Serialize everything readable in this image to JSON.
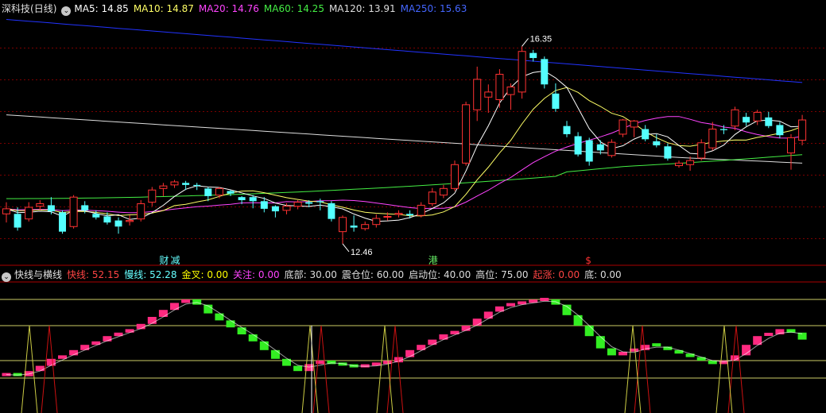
{
  "main_legend": {
    "stock": "深科技",
    "period": "(日线)",
    "items": [
      {
        "label": "MA5:",
        "value": "14.85",
        "color": "#ffffff"
      },
      {
        "label": "MA10:",
        "value": "14.87",
        "color": "#ffff66"
      },
      {
        "label": "MA20:",
        "value": "14.76",
        "color": "#ff44ff"
      },
      {
        "label": "MA60:",
        "value": "14.25",
        "color": "#44ee44"
      },
      {
        "label": "MA120:",
        "value": "13.91",
        "color": "#dddddd"
      },
      {
        "label": "MA250:",
        "value": "15.63",
        "color": "#4466ff"
      }
    ]
  },
  "sub_legend": {
    "name": "快线与横线",
    "items": [
      {
        "label": "快线:",
        "value": "52.15",
        "color": "#ff4444"
      },
      {
        "label": "慢线:",
        "value": "52.28",
        "color": "#66ffff"
      },
      {
        "label": "金叉:",
        "value": "0.00",
        "color": "#ffff00"
      },
      {
        "label": "关注:",
        "value": "0.00",
        "color": "#ff44ff"
      },
      {
        "label": "底部:",
        "value": "30.00",
        "color": "#dddddd"
      },
      {
        "label": "震仓位:",
        "value": "60.00",
        "color": "#dddddd"
      },
      {
        "label": "启动位:",
        "value": "40.00",
        "color": "#dddddd"
      },
      {
        "label": "高位:",
        "value": "75.00",
        "color": "#dddddd"
      },
      {
        "label": "起涨:",
        "value": "0.00",
        "color": "#ff4444"
      },
      {
        "label": "底:",
        "value": "0.00",
        "color": "#dddddd"
      }
    ]
  },
  "colors": {
    "up": "#ff3232",
    "down": "#54ffff",
    "ma5": "#ffffff",
    "ma10": "#ffff66",
    "ma20": "#ff44ff",
    "ma60": "#44ee44",
    "ma120": "#dddddd",
    "ma250": "#2233ff",
    "grid": "#7a0000",
    "bar_up": "#ff2a80",
    "bar_down": "#33ee22",
    "signal_red": "#cc1111",
    "signal_yellow": "#cccc44"
  },
  "chart_data": [
    {
      "type": "candlestick",
      "period": "daily",
      "ylim": [
        12.1,
        16.95
      ],
      "annotations": [
        {
          "text": "16.35",
          "index": 46,
          "value": 16.35
        },
        {
          "text": "12.46",
          "index": 30,
          "value": 12.46
        }
      ],
      "markers": [
        {
          "text": "财",
          "index": 14,
          "color": "#66ffff"
        },
        {
          "text": "减",
          "index": 15,
          "color": "#66ffff"
        },
        {
          "text": "港",
          "index": 38,
          "color": "#66ee66"
        },
        {
          "text": "$",
          "index": 52,
          "color": "#ff3232"
        }
      ],
      "candles": [
        [
          13.05,
          13.15,
          12.88,
          13.28
        ],
        [
          13.05,
          12.78,
          12.72,
          13.18
        ],
        [
          12.95,
          13.18,
          12.9,
          13.28
        ],
        [
          13.2,
          13.25,
          13.12,
          13.32
        ],
        [
          13.22,
          13.1,
          13.04,
          13.38
        ],
        [
          13.08,
          12.7,
          12.66,
          13.12
        ],
        [
          12.8,
          13.38,
          12.76,
          13.42
        ],
        [
          13.22,
          13.12,
          13.06,
          13.3
        ],
        [
          13.05,
          12.98,
          12.94,
          13.12
        ],
        [
          13.0,
          12.88,
          12.84,
          13.08
        ],
        [
          12.92,
          12.8,
          12.66,
          12.98
        ],
        [
          12.9,
          12.92,
          12.82,
          13.02
        ],
        [
          12.95,
          13.25,
          12.9,
          13.32
        ],
        [
          13.28,
          13.52,
          13.2,
          13.58
        ],
        [
          13.55,
          13.6,
          13.4,
          13.66
        ],
        [
          13.62,
          13.68,
          13.56,
          13.72
        ],
        [
          13.66,
          13.62,
          13.52,
          13.7
        ],
        [
          13.62,
          13.6,
          13.52,
          13.66
        ],
        [
          13.55,
          13.4,
          13.3,
          13.58
        ],
        [
          13.42,
          13.55,
          13.36,
          13.58
        ],
        [
          13.5,
          13.45,
          13.4,
          13.52
        ],
        [
          13.38,
          13.32,
          13.24,
          13.4
        ],
        [
          13.38,
          13.3,
          13.16,
          13.42
        ],
        [
          13.3,
          13.15,
          13.08,
          13.38
        ],
        [
          13.2,
          13.1,
          12.98,
          13.22
        ],
        [
          13.12,
          13.2,
          13.04,
          13.26
        ],
        [
          13.2,
          13.28,
          13.14,
          13.32
        ],
        [
          13.28,
          13.25,
          13.18,
          13.32
        ],
        [
          13.3,
          13.28,
          13.12,
          13.35
        ],
        [
          13.26,
          12.95,
          12.9,
          13.3
        ],
        [
          12.7,
          12.98,
          12.46,
          13.02
        ],
        [
          12.82,
          12.78,
          12.7,
          13.02
        ],
        [
          12.76,
          12.84,
          12.72,
          12.9
        ],
        [
          12.84,
          12.96,
          12.78,
          13.04
        ],
        [
          13.0,
          13.0,
          12.92,
          13.08
        ],
        [
          13.04,
          13.06,
          12.98,
          13.12
        ],
        [
          13.05,
          13.02,
          12.96,
          13.12
        ],
        [
          13.02,
          13.22,
          12.98,
          13.28
        ],
        [
          13.25,
          13.48,
          13.2,
          13.56
        ],
        [
          13.42,
          13.55,
          13.36,
          13.62
        ],
        [
          13.55,
          14.02,
          13.5,
          14.1
        ],
        [
          14.05,
          15.2,
          14.0,
          15.26
        ],
        [
          15.1,
          15.7,
          14.88,
          15.95
        ],
        [
          15.35,
          15.45,
          15.04,
          15.6
        ],
        [
          15.3,
          15.8,
          15.14,
          15.9
        ],
        [
          15.4,
          15.55,
          15.1,
          15.62
        ],
        [
          15.45,
          16.25,
          15.32,
          16.35
        ],
        [
          16.22,
          16.12,
          16.05,
          16.28
        ],
        [
          16.1,
          15.6,
          15.52,
          16.15
        ],
        [
          15.42,
          15.12,
          15.06,
          15.62
        ],
        [
          14.78,
          14.62,
          14.56,
          14.88
        ],
        [
          14.58,
          14.22,
          14.18,
          14.66
        ],
        [
          14.5,
          14.08,
          14.0,
          14.55
        ],
        [
          14.42,
          14.3,
          14.22,
          14.5
        ],
        [
          14.2,
          14.46,
          14.16,
          14.52
        ],
        [
          14.62,
          14.9,
          14.56,
          14.92
        ],
        [
          14.76,
          14.88,
          14.56,
          14.9
        ],
        [
          14.72,
          14.52,
          14.48,
          14.8
        ],
        [
          14.48,
          14.4,
          14.36,
          14.62
        ],
        [
          14.38,
          14.14,
          14.1,
          14.44
        ],
        [
          14.0,
          14.05,
          13.96,
          14.1
        ],
        [
          14.02,
          14.1,
          13.9,
          14.18
        ],
        [
          14.15,
          14.45,
          14.1,
          14.52
        ],
        [
          14.35,
          14.72,
          14.3,
          14.86
        ],
        [
          14.72,
          14.7,
          14.62,
          14.8
        ],
        [
          14.78,
          15.1,
          14.7,
          15.16
        ],
        [
          14.96,
          14.85,
          14.78,
          15.04
        ],
        [
          14.88,
          15.05,
          14.8,
          15.1
        ],
        [
          14.95,
          14.78,
          14.74,
          15.06
        ],
        [
          14.8,
          14.6,
          14.54,
          14.86
        ],
        [
          14.25,
          14.55,
          13.92,
          14.62
        ],
        [
          14.5,
          14.9,
          14.4,
          15.0
        ]
      ]
    },
    {
      "type": "bar",
      "title": "快线与横线",
      "ylim": [
        10,
        85
      ],
      "hlines": [
        30,
        40,
        60,
        75
      ],
      "values": [
        32,
        31,
        34,
        37,
        41,
        43,
        46,
        49,
        51,
        54,
        56,
        58,
        61,
        65,
        69,
        73,
        75,
        72,
        67,
        63,
        59,
        55,
        51,
        46,
        41,
        37,
        34,
        38,
        40,
        38,
        37,
        36,
        37,
        38,
        39,
        42,
        46,
        49,
        52,
        55,
        57,
        60,
        64,
        68,
        71,
        72,
        73,
        74,
        75,
        72,
        66,
        60,
        54,
        47,
        43,
        45,
        46,
        49,
        48,
        46,
        44,
        42,
        40,
        38,
        40,
        43,
        49,
        54,
        55,
        58,
        56,
        52
      ],
      "signals_red": [
        7,
        49,
        53,
        60,
        73,
        75,
        82,
        121,
        125
      ],
      "signals_yellow": [
        5,
        55,
        69,
        71,
        119
      ]
    }
  ]
}
